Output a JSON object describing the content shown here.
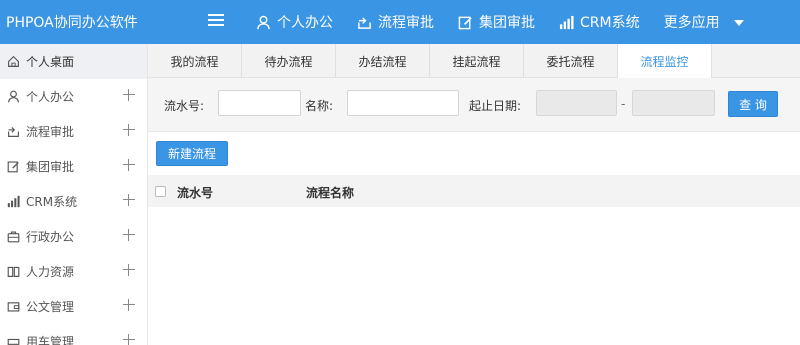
{
  "app": {
    "title": "PHPOA协同办公软件"
  },
  "topnav": [
    {
      "label": "个人办公",
      "icon": "user-icon"
    },
    {
      "label": "流程审批",
      "icon": "flow-icon"
    },
    {
      "label": "集团审批",
      "icon": "edit-icon"
    },
    {
      "label": "CRM系统",
      "icon": "bar-chart-icon"
    }
  ],
  "more": {
    "label": "更多应用"
  },
  "sidebar": {
    "items": [
      {
        "label": "个人桌面",
        "icon": "home-icon"
      },
      {
        "label": "个人办公",
        "icon": "user-icon"
      },
      {
        "label": "流程审批",
        "icon": "flow-icon"
      },
      {
        "label": "集团审批",
        "icon": "edit-icon"
      },
      {
        "label": "CRM系统",
        "icon": "bar-chart-icon"
      },
      {
        "label": "行政办公",
        "icon": "briefcase-icon"
      },
      {
        "label": "人力资源",
        "icon": "book-icon"
      },
      {
        "label": "公文管理",
        "icon": "folder-icon"
      },
      {
        "label": "用车管理",
        "icon": "car-icon"
      }
    ]
  },
  "tabs": [
    {
      "label": "我的流程"
    },
    {
      "label": "待办流程"
    },
    {
      "label": "办结流程"
    },
    {
      "label": "挂起流程"
    },
    {
      "label": "委托流程"
    },
    {
      "label": "流程监控"
    }
  ],
  "search": {
    "serial_label": "流水号:",
    "serial_value": "",
    "name_label": "名称:",
    "name_value": "",
    "date_label": "起止日期:",
    "date_separator": "-",
    "query_button": "查 询"
  },
  "actions": {
    "new_flow": "新建流程"
  },
  "table": {
    "columns": [
      "流水号",
      "流程名称"
    ]
  }
}
